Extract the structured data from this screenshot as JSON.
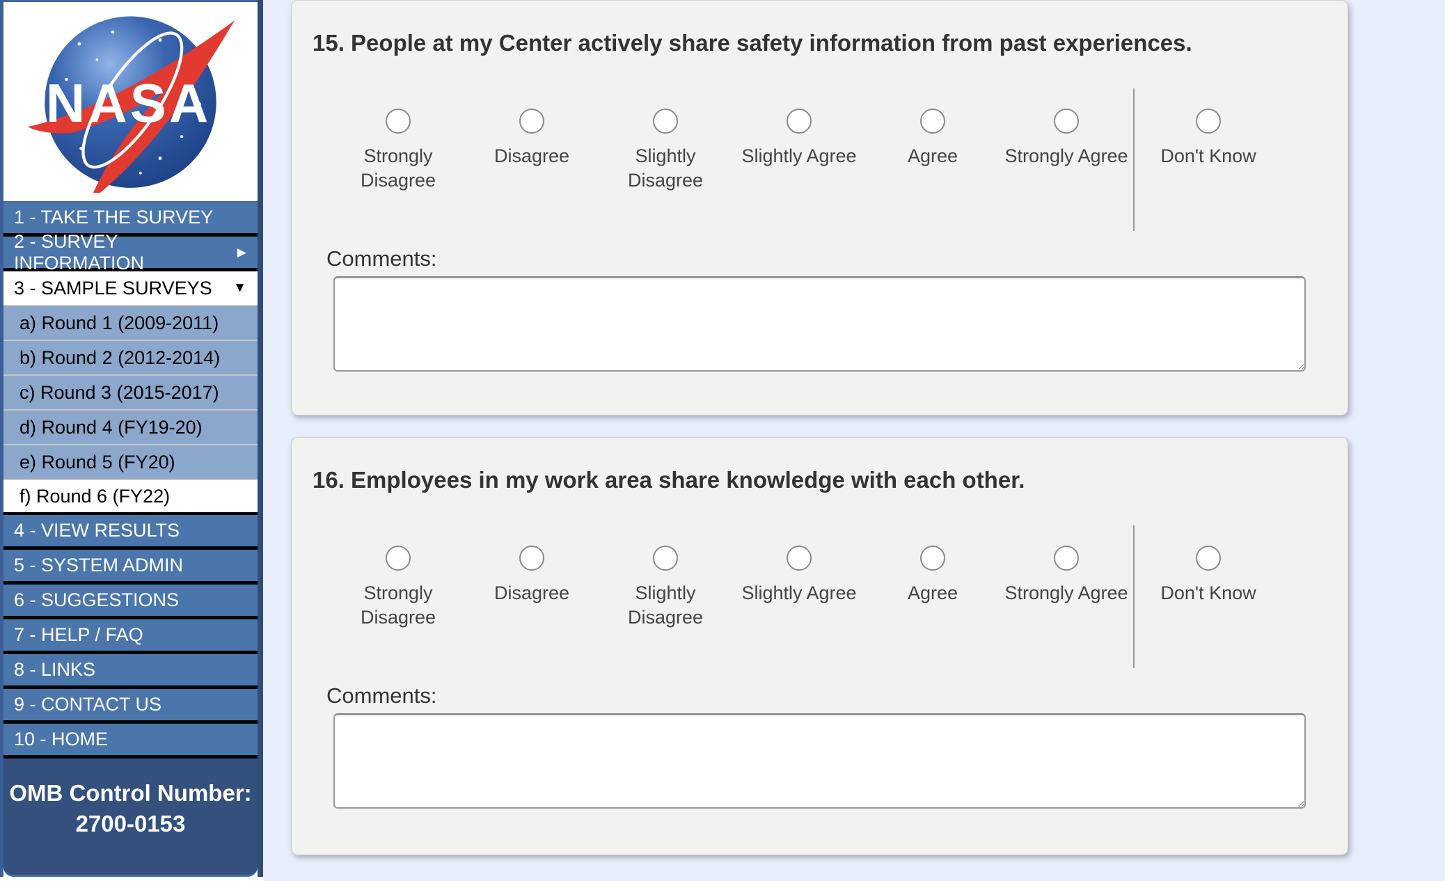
{
  "page": {
    "background_color": "#e8eefb"
  },
  "sidebar": {
    "logo": {
      "name": "nasa-meatball-logo",
      "text": "NASA"
    },
    "menu": [
      {
        "label": "1 - TAKE THE SURVEY",
        "type": "primary"
      },
      {
        "label": "2 - SURVEY INFORMATION",
        "type": "primary",
        "arrow": "right"
      },
      {
        "label": "3 - SAMPLE SURVEYS",
        "type": "expanded",
        "arrow": "down"
      },
      {
        "label": "a) Round 1 (2009-2011)",
        "type": "sub"
      },
      {
        "label": "b) Round 2 (2012-2014)",
        "type": "sub"
      },
      {
        "label": "c) Round 3 (2015-2017)",
        "type": "sub"
      },
      {
        "label": "d) Round 4 (FY19-20)",
        "type": "sub"
      },
      {
        "label": "e) Round 5 (FY20)",
        "type": "sub"
      },
      {
        "label": "f) Round 6 (FY22)",
        "type": "sub",
        "active": true
      },
      {
        "label": "4 - VIEW RESULTS",
        "type": "primary"
      },
      {
        "label": "5 - SYSTEM ADMIN",
        "type": "primary"
      },
      {
        "label": "6 - SUGGESTIONS",
        "type": "primary"
      },
      {
        "label": "7 - HELP / FAQ",
        "type": "primary"
      },
      {
        "label": "8 - LINKS",
        "type": "primary"
      },
      {
        "label": "9 - CONTACT US",
        "type": "primary"
      },
      {
        "label": "10 - HOME",
        "type": "primary"
      }
    ],
    "omb": {
      "line1": "OMB Control Number:",
      "line2": "2700-0153"
    }
  },
  "survey": {
    "options": [
      "Strongly Disagree",
      "Disagree",
      "Slightly Disagree",
      "Slightly Agree",
      "Agree",
      "Strongly Agree"
    ],
    "dont_know_label": "Don't Know",
    "comments_label": "Comments:",
    "questions": [
      {
        "text": "15. People at my Center actively share safety information from past experiences.",
        "selected_option": null,
        "comment_value": ""
      },
      {
        "text": "16. Employees in my work area share knowledge with each other.",
        "selected_option": null,
        "comment_value": ""
      }
    ]
  },
  "colors": {
    "menu_blue": "#4b76ab",
    "submenu_blue": "#8ca7cc",
    "omb_navy": "#34517e",
    "card_background": "#f2f2f1",
    "page_background": "#e8eefb",
    "nasa_red": "#e13a30",
    "nasa_blue": "#2a54a5"
  }
}
